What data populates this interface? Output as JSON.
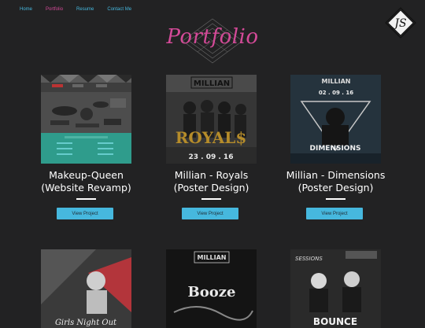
{
  "nav": {
    "items": [
      {
        "label": "Home",
        "color": "#46b8de"
      },
      {
        "label": "Portfolio",
        "color": "#d44a98"
      },
      {
        "label": "Resume",
        "color": "#46b8de"
      },
      {
        "label": "Contact Me",
        "color": "#46b8de"
      }
    ]
  },
  "logo": {
    "text": "JS"
  },
  "page": {
    "title": "Portfolio"
  },
  "projects": [
    {
      "title_line1": "Makeup-Queen",
      "title_line2": "(Website Revamp)",
      "button": "View Project"
    },
    {
      "title_line1": "Millian - Royals",
      "title_line2": "(Poster Design)",
      "button": "View Project",
      "poster": {
        "brand": "MILLIAN",
        "word": "ROYAL$",
        "date": "23 . 09 . 16"
      }
    },
    {
      "title_line1": "Millian - Dimensions",
      "title_line2": "(Poster Design)",
      "button": "View Project",
      "poster": {
        "brand": "MILLIAN",
        "date": "02 . 09 . 16",
        "word": "DIMENSIONS"
      }
    }
  ],
  "row2": [
    {
      "poster_text": "Girls Night Out"
    },
    {
      "poster": {
        "brand": "MILLIAN",
        "word": "Booze"
      }
    },
    {
      "poster": {
        "brand": "SESSIONS",
        "word": "BOUNCE"
      }
    }
  ]
}
